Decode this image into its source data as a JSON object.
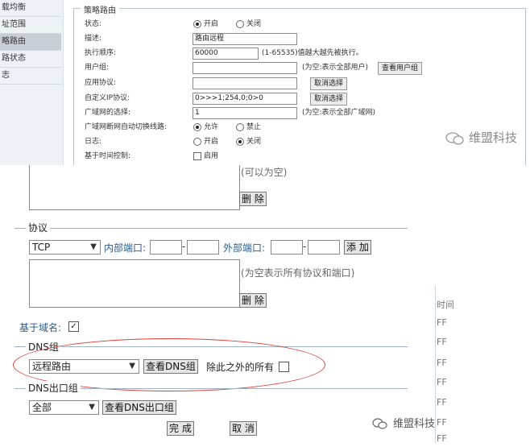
{
  "sidebar": {
    "items": [
      {
        "label": "载均衡"
      },
      {
        "label": "址范围"
      },
      {
        "label": "略路由"
      },
      {
        "label": "路状态"
      },
      {
        "label": "志"
      }
    ]
  },
  "strategy": {
    "legend": "策略路由",
    "status": {
      "label": "状态:",
      "on": "开启",
      "off": "关闭"
    },
    "description": {
      "label": "描述:",
      "value": "路由远程"
    },
    "order": {
      "label": "执行顺序:",
      "value": "60000",
      "hint": "(1-65535)值越大越先被执行。"
    },
    "user_group": {
      "label": "用户组:",
      "hint": "(为空:表示全部用户)",
      "button": "查看用户组"
    },
    "app_protocol": {
      "label": "应用协议:",
      "button": "取消选择"
    },
    "custom_ip": {
      "label": "自定义IP协议:",
      "value": "0>>>1;254,0;0>0",
      "button": "取消选择"
    },
    "wan_select": {
      "label": "广域网的选择:",
      "value": "1",
      "hint": "(为空:表示全部广域网)"
    },
    "auto_switch": {
      "label": "广域网断网自动切换线路:",
      "allow": "允许",
      "deny": "禁止"
    },
    "log": {
      "label": "日志:",
      "on": "开启",
      "off": "关闭"
    },
    "time_control": {
      "label": "基于时间控制:",
      "enable": "启用"
    }
  },
  "watermark_top": "维盟科技",
  "bottom": {
    "top_note": "(可以为空)",
    "delete_label": "删 除",
    "protocol": {
      "title": "协议",
      "select": "TCP",
      "inner_port_label": "内部端口:",
      "outer_port_label": "外部端口:",
      "add_label": "添 加",
      "note": "(为空表示所有协议和端口)",
      "delete_label": "删 除"
    },
    "domain": {
      "label": "基于域名:",
      "checked": "✓"
    },
    "dns_group": {
      "title": "DNS组",
      "select": "远程路由",
      "view_button": "查看DNS组",
      "except_label": "除此之外的所有"
    },
    "dns_out": {
      "title": "DNS出口组",
      "select": "全部",
      "view_button": "查看DNS出口组"
    },
    "finish_label": "完 成",
    "cancel_label": "取 消",
    "right_strip": [
      "时间",
      "FF",
      "FF",
      "FF",
      "FF",
      "FF",
      "FF",
      "FF"
    ]
  },
  "watermark_bottom": "维盟科技",
  "colors": {
    "accent_red": "#d9433b",
    "label_blue": "#2b5c8a"
  }
}
